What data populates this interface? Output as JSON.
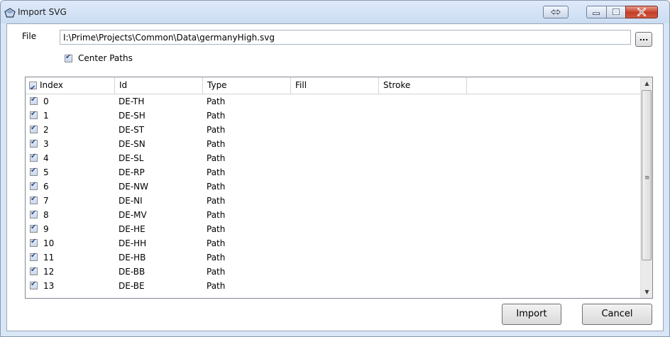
{
  "window": {
    "title": "Import SVG"
  },
  "file": {
    "label": "File",
    "path": "I:\\Prime\\Projects\\Common\\Data\\germanyHigh.svg",
    "browse_label": "..."
  },
  "options": {
    "center_paths_label": "Center Paths",
    "center_paths_checked": true
  },
  "table": {
    "columns": [
      "Index",
      "Id",
      "Type",
      "Fill",
      "Stroke"
    ],
    "rows": [
      {
        "index": "0",
        "id": "DE-TH",
        "type": "Path",
        "checked": true
      },
      {
        "index": "1",
        "id": "DE-SH",
        "type": "Path",
        "checked": true
      },
      {
        "index": "2",
        "id": "DE-ST",
        "type": "Path",
        "checked": true
      },
      {
        "index": "3",
        "id": "DE-SN",
        "type": "Path",
        "checked": true
      },
      {
        "index": "4",
        "id": "DE-SL",
        "type": "Path",
        "checked": true
      },
      {
        "index": "5",
        "id": "DE-RP",
        "type": "Path",
        "checked": true
      },
      {
        "index": "6",
        "id": "DE-NW",
        "type": "Path",
        "checked": true
      },
      {
        "index": "7",
        "id": "DE-NI",
        "type": "Path",
        "checked": true
      },
      {
        "index": "8",
        "id": "DE-MV",
        "type": "Path",
        "checked": true
      },
      {
        "index": "9",
        "id": "DE-HE",
        "type": "Path",
        "checked": true
      },
      {
        "index": "10",
        "id": "DE-HH",
        "type": "Path",
        "checked": true
      },
      {
        "index": "11",
        "id": "DE-HB",
        "type": "Path",
        "checked": true
      },
      {
        "index": "12",
        "id": "DE-BB",
        "type": "Path",
        "checked": true
      },
      {
        "index": "13",
        "id": "DE-BE",
        "type": "Path",
        "checked": true
      }
    ]
  },
  "buttons": {
    "import_label": "Import",
    "cancel_label": "Cancel"
  },
  "icons": {
    "title": "pentagon-icon",
    "swap": "swap-arrows-icon",
    "minimize": "minimize-icon",
    "maximize": "maximize-icon",
    "close": "close-icon"
  },
  "colors": {
    "titlebar": "#cbdcf2",
    "close_button": "#c43e26",
    "checkbox_check": "#2a4a8a"
  }
}
